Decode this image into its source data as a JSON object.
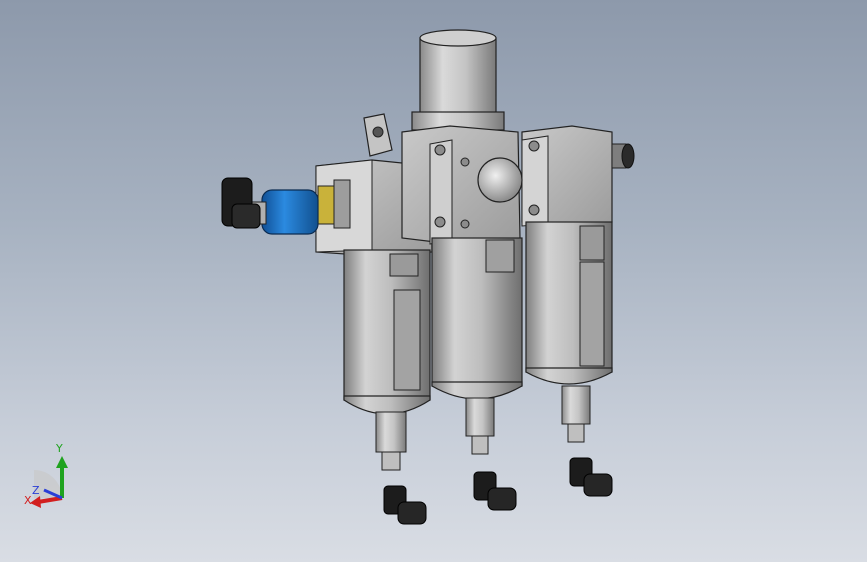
{
  "triad": {
    "x_label": "X",
    "y_label": "Y",
    "z_label": "Z",
    "x_color": "#d21f1f",
    "y_color": "#1fa31f",
    "z_color": "#2a3ed6"
  },
  "colors": {
    "background_top": "#8d99ab",
    "background_bottom": "#d9dde4",
    "body_gray": "#b9b9b9",
    "fitting_black": "#1c1c1c",
    "gauge_blue": "#1e73c8",
    "brass": "#c9b23a"
  },
  "icons": {
    "coordinate_triad": "xyz-triad-icon"
  }
}
